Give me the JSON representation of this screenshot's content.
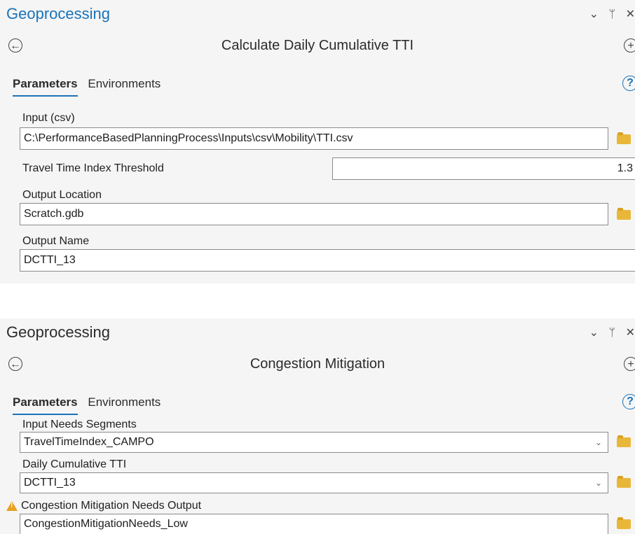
{
  "panel1": {
    "title": "Geoprocessing",
    "controls": {
      "menu": "⌄",
      "pin": "ᛘ",
      "close": "✕"
    },
    "back_glyph": "←",
    "add_glyph": "+",
    "tool_title": "Calculate Daily Cumulative TTI",
    "tabs": [
      "Parameters",
      "Environments"
    ],
    "help_glyph": "?",
    "params": {
      "input_label": "Input (csv)",
      "input_value": "C:\\PerformanceBasedPlanningProcess\\Inputs\\csv\\Mobility\\TTI.csv",
      "threshold_label": "Travel Time Index Threshold",
      "threshold_value": "1.3",
      "output_location_label": "Output Location",
      "output_location_value": "Scratch.gdb",
      "output_name_label": "Output Name",
      "output_name_value": "DCTTI_13"
    }
  },
  "panel2": {
    "title": "Geoprocessing",
    "controls": {
      "menu": "⌄",
      "pin": "ᛘ",
      "close": "✕"
    },
    "back_glyph": "←",
    "add_glyph": "+",
    "tool_title": "Congestion Mitigation",
    "tabs": [
      "Parameters",
      "Environments"
    ],
    "help_glyph": "?",
    "params": {
      "segments_label": "Input Needs Segments",
      "segments_value": "TravelTimeIndex_CAMPO",
      "daily_label": "Daily Cumulative TTI",
      "daily_value": "DCTTI_13",
      "output_label": "Congestion Mitigation Needs Output",
      "output_value": "CongestionMitigationNeeds_Low"
    },
    "dropdown_glyph": "⌄",
    "warning_glyph": "!"
  },
  "colors": {
    "accent": "#1a73b8",
    "folder": "#e8b73a",
    "warning": "#e8a020"
  }
}
